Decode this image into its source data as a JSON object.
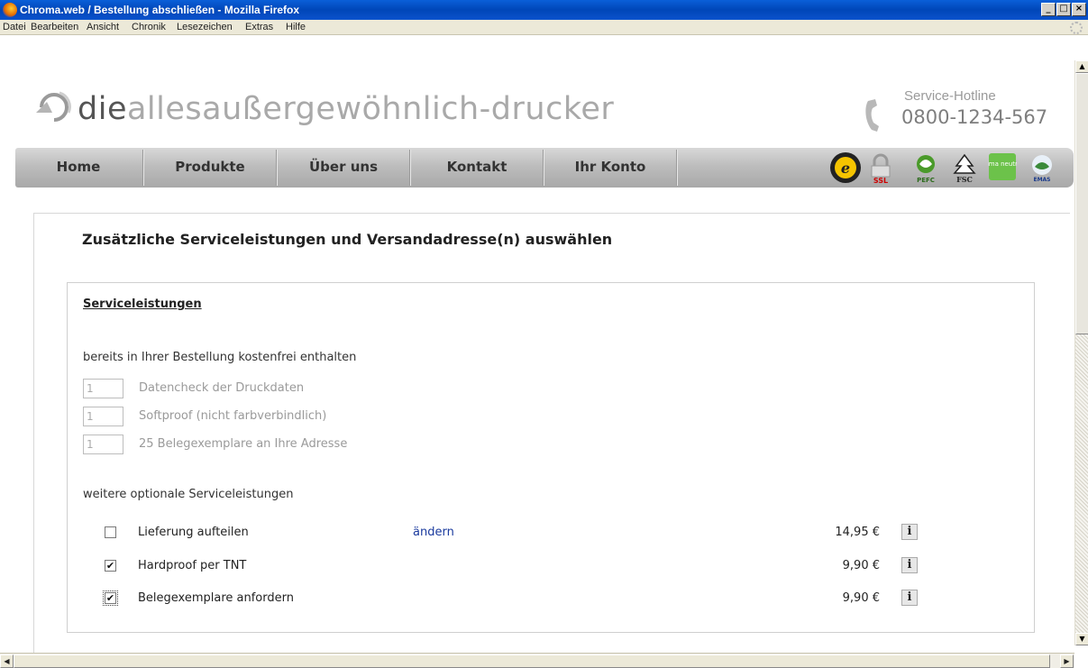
{
  "window": {
    "title": "Chroma.web / Bestellung abschließen - Mozilla Firefox",
    "buttons": [
      "_",
      "□",
      "×"
    ]
  },
  "menu": [
    "Datei",
    "Bearbeiten",
    "Ansicht",
    "Chronik",
    "Lesezeichen",
    "Extras",
    "Hilfe"
  ],
  "header": {
    "logo_die": "die",
    "logo_rest": "allesaußergewöhnlich-drucker",
    "hotline_label": "Service-Hotline",
    "hotline_number": "0800-1234-567"
  },
  "nav": {
    "items": [
      "Home",
      "Produkte",
      "Über uns",
      "Kontakt",
      "Ihr Konto"
    ],
    "badges": [
      "trusted-shops-icon",
      "ssl-lock-icon",
      "pefc-icon",
      "fsc-icon",
      "klimaneutral-icon",
      "emas-icon"
    ],
    "badge_labels": {
      "ssl": "SSL",
      "pefc": "PEFC",
      "fsc": "FSC",
      "klima": "klima neutral",
      "emas": "EMAS"
    }
  },
  "page": {
    "title": "Zusätzliche Serviceleistungen und Versandadresse(n) auswählen",
    "section_title": "Serviceleistungen",
    "included_heading": "bereits in Ihrer Bestellung kostenfrei enthalten",
    "included": [
      {
        "qty": "1",
        "label": "Datencheck der Druckdaten"
      },
      {
        "qty": "1",
        "label": "Softproof (nicht farbverbindlich)"
      },
      {
        "qty": "1",
        "label": "25 Belegexemplare an Ihre Adresse"
      }
    ],
    "optional_heading": "weitere optionale Serviceleistungen",
    "optional": [
      {
        "checked": false,
        "label": "Lieferung aufteilen",
        "link": "ändern",
        "price": "14,95 €",
        "info": "i"
      },
      {
        "checked": true,
        "label": "Hardproof per TNT",
        "link": "",
        "price": "9,90 €",
        "info": "i"
      },
      {
        "checked": true,
        "label": "Belegexemplare anfordern",
        "link": "",
        "price": "9,90 €",
        "info": "i"
      }
    ]
  },
  "colors": {
    "titlebar": "#0a5fd8",
    "nav_gradient_top": "#d8d8d8",
    "nav_gradient_bottom": "#a8a8a8",
    "link": "#1a3a9e",
    "logo_grey": "#a9a9a9"
  }
}
